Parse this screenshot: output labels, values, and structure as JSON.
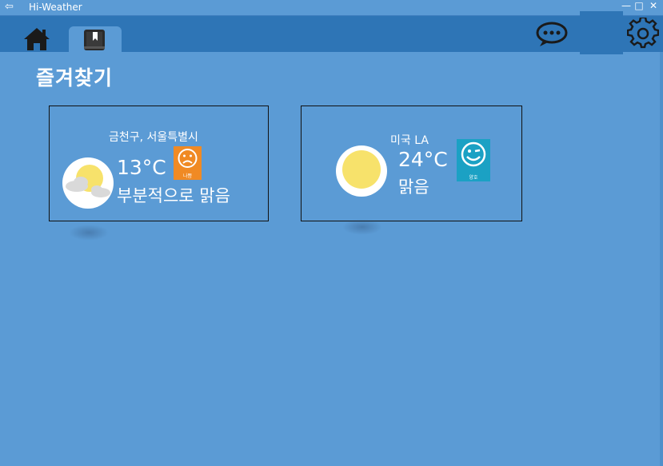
{
  "window": {
    "title": "Hi-Weather",
    "back_glyph": "⇦",
    "minimize_glyph": "—",
    "maximize_glyph": "□",
    "close_glyph": "✕"
  },
  "toolbar": {
    "home_icon": "home-icon",
    "favorites_icon": "bookmark-book-icon",
    "chat_icon": "chat-bubble-icon",
    "settings_icon": "gear-icon"
  },
  "page": {
    "title": "즐겨찾기"
  },
  "favorites": [
    {
      "location": "금천구, 서울특별시",
      "temperature": "13°C",
      "condition": "부분적으로 맑음",
      "weather_icon": "partly-cloudy-icon",
      "mood": {
        "label": "나쁨",
        "face": "sad",
        "color": "#f08a24"
      }
    },
    {
      "location": "미국 LA",
      "temperature": "24°C",
      "condition": "맑음",
      "weather_icon": "sunny-icon",
      "mood": {
        "label": "양호",
        "face": "wink",
        "color": "#1ba1c4"
      }
    }
  ],
  "colors": {
    "background": "#5b9bd5",
    "toolbar": "#2e75b6",
    "text": "#ffffff"
  }
}
